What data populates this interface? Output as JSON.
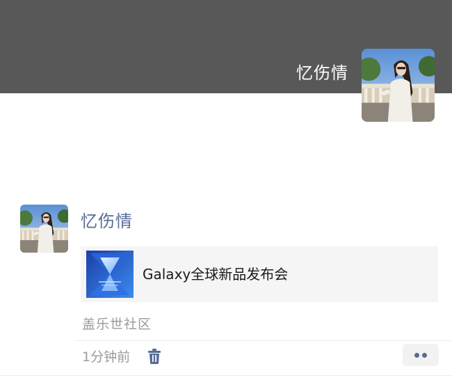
{
  "cover": {
    "user_name": "忆伤情",
    "background_color": "#585858"
  },
  "post": {
    "user_name": "忆伤情",
    "share": {
      "title": "Galaxy全球新品发布会",
      "thumbnail_icon": "galaxy-event-thumbnail"
    },
    "source": "盖乐世社区",
    "time": "1分钟前",
    "delete_icon": "trash-icon",
    "more_icon": "more-dots-icon"
  },
  "colors": {
    "name_link": "#576b95",
    "meta_text": "#9a9a9a",
    "card_bg": "#f5f5f5"
  }
}
